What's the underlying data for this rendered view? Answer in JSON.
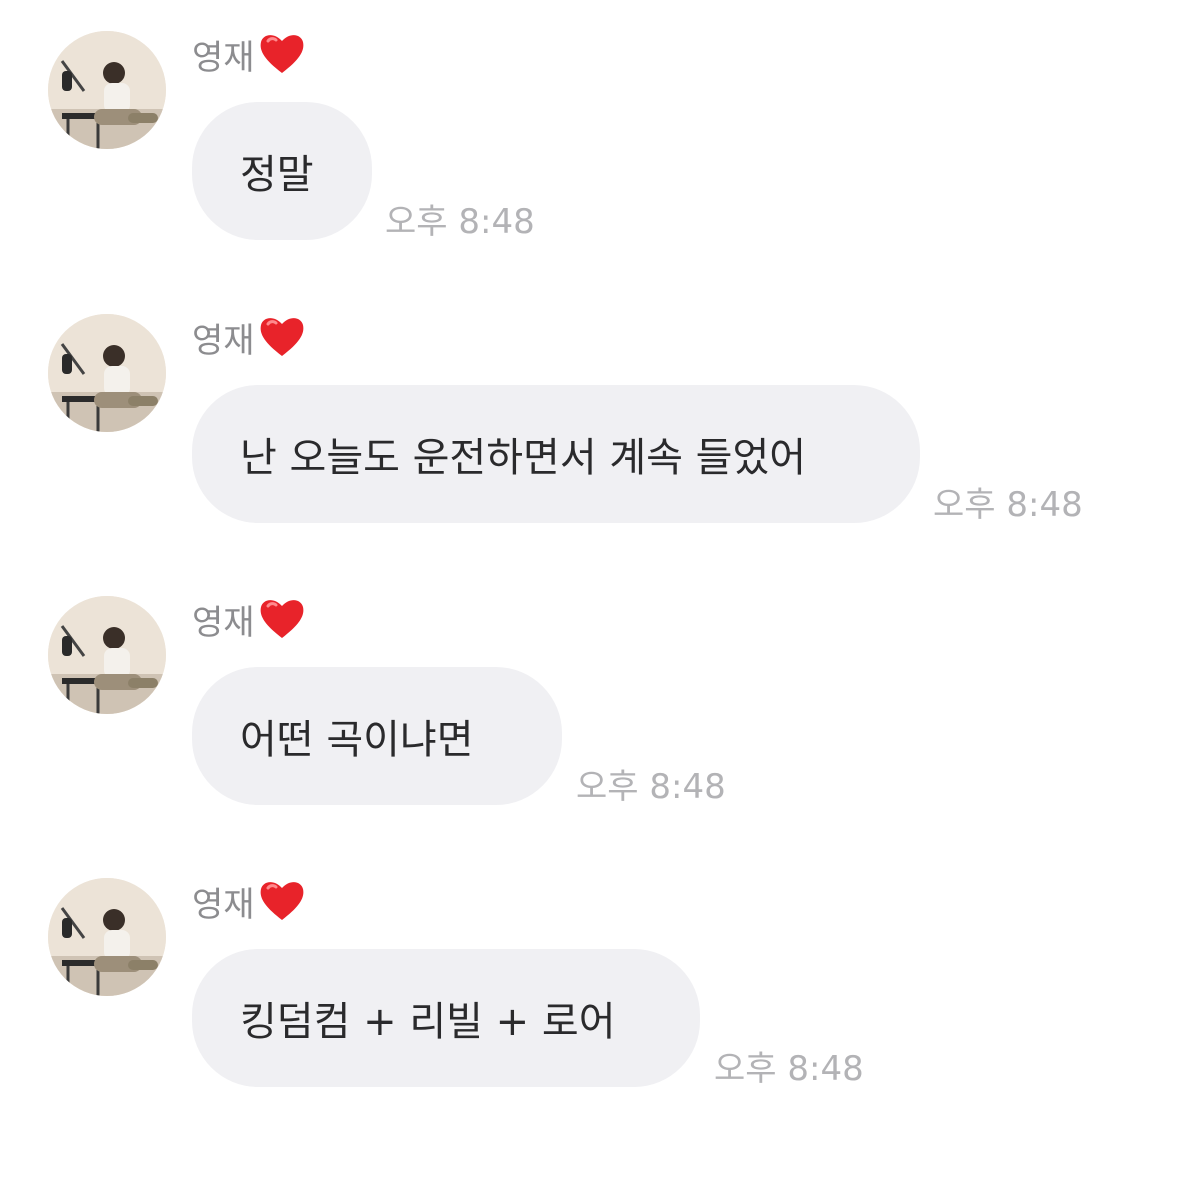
{
  "messages": [
    {
      "sender": "영재",
      "text": "정말",
      "time": "오후 8:48"
    },
    {
      "sender": "영재",
      "text": "난 오늘도 운전하면서 계속 들었어",
      "time": "오후 8:48"
    },
    {
      "sender": "영재",
      "text": "어떤 곡이냐면",
      "time": "오후 8:48"
    },
    {
      "sender": "영재",
      "text": "킹덤컴 + 리빌 + 로어",
      "time": "오후 8:48"
    }
  ],
  "colors": {
    "bubble": "#f0f0f3",
    "sender": "#8c8c8f",
    "timestamp": "#b3b3b6",
    "heart": "#e8232a"
  },
  "icons": {
    "avatar": "profile-photo",
    "heart": "red-heart-emoji"
  }
}
